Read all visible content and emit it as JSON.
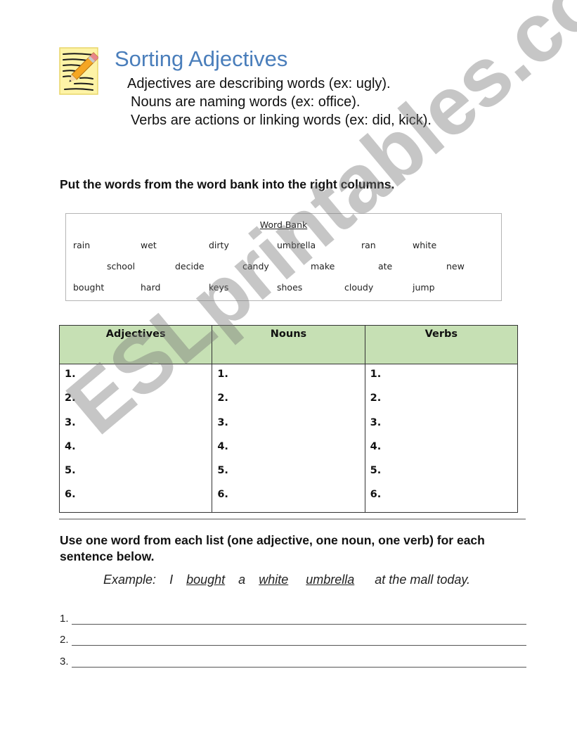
{
  "header": {
    "title": "Sorting Adjectives",
    "logo_icon": "notepad-pencil-icon",
    "definitions": [
      "Adjectives are describing words (ex: ugly).",
      "Nouns are naming words (ex: office).",
      "Verbs are actions or linking words (ex: did, kick)."
    ]
  },
  "section1": {
    "instruction": "Put the words from the word bank into the right columns."
  },
  "word_bank": {
    "title": "Word Bank",
    "rows": [
      [
        "rain",
        "wet",
        "dirty",
        "umbrella",
        "ran",
        "white"
      ],
      [
        "school",
        "decide",
        "candy",
        "make",
        "ate",
        "new"
      ],
      [
        "bought",
        "hard",
        "keys",
        "shoes",
        "cloudy",
        "jump"
      ]
    ]
  },
  "sort_table": {
    "headers": [
      "Adjectives",
      "Nouns",
      "Verbs"
    ],
    "numbers": [
      "1.",
      "2.",
      "3.",
      "4.",
      "5.",
      "6."
    ]
  },
  "section2": {
    "instruction": "Use one word from each list (one adjective, one noun, one verb) for each sentence below.",
    "example": {
      "label": "Example:",
      "parts": [
        "I",
        "bought",
        "a",
        "white",
        "umbrella",
        "at the mall today."
      ]
    },
    "lines": [
      "1.",
      "2.",
      "3."
    ]
  },
  "watermark": "ESLprintables.com",
  "colors": {
    "title": "#4a7ebb",
    "table_header_bg": "#c6e0b4"
  }
}
